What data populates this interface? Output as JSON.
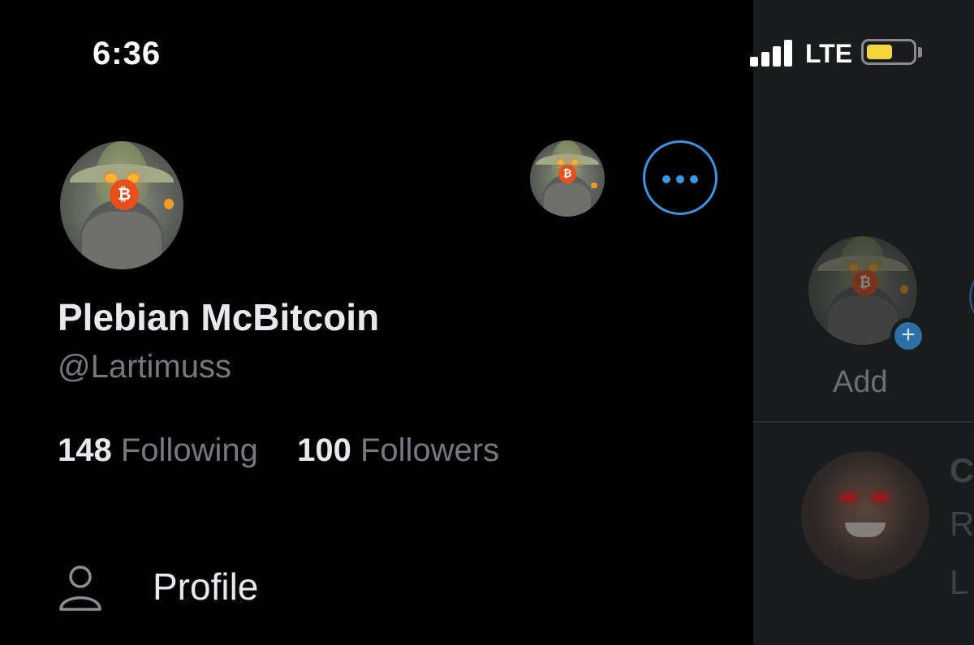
{
  "status_bar": {
    "time": "6:36",
    "network": "LTE",
    "battery_level": 0.55,
    "battery_color": "#f5d33c"
  },
  "drawer": {
    "display_name": "Plebian McBitcoin",
    "handle": "@Lartimuss",
    "following_count": "148",
    "following_label": "Following",
    "followers_count": "100",
    "followers_label": "Followers",
    "menu": [
      {
        "label": "Profile",
        "icon": "person-icon"
      }
    ],
    "more_button_icon": "ellipsis-icon",
    "accent_color": "#3f93e6"
  },
  "background_panel": {
    "add_account_label": "Add",
    "peek_letters": [
      "C",
      "R",
      "L"
    ]
  }
}
